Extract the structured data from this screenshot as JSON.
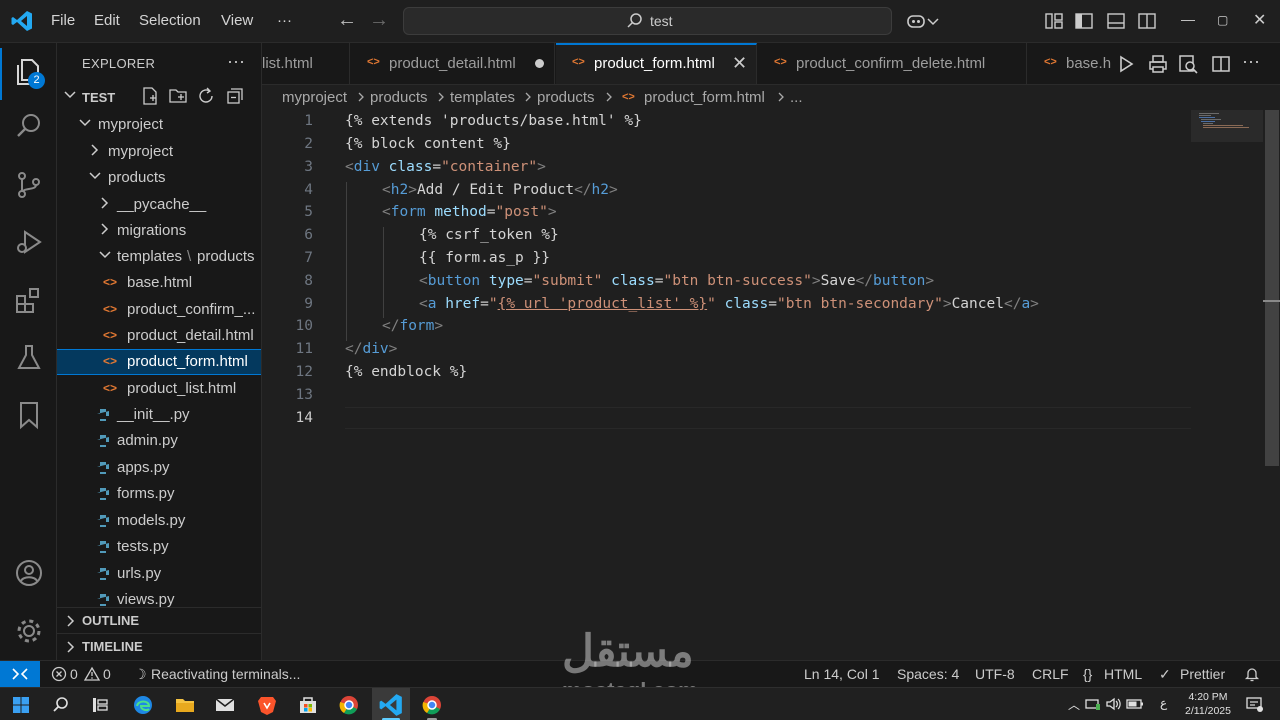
{
  "titlebar": {
    "menu": [
      "File",
      "Edit",
      "Selection",
      "View",
      "···"
    ],
    "search_text": "test"
  },
  "activity": {
    "explorer_badge": "2"
  },
  "explorer": {
    "title": "EXPLORER",
    "more": "···",
    "root": "TEST",
    "items": [
      {
        "label": "myproject",
        "kind": "folder",
        "open": true
      },
      {
        "label": "myproject",
        "kind": "folder",
        "open": false
      },
      {
        "label": "products",
        "kind": "folder",
        "open": true
      },
      {
        "label": "__pycache__",
        "kind": "folder",
        "open": false
      },
      {
        "label": "migrations",
        "kind": "folder",
        "open": false
      },
      {
        "label": "templates",
        "kind": "folder",
        "open": true
      },
      {
        "label": "base.html",
        "kind": "html"
      },
      {
        "label": "product_confirm_...",
        "kind": "html"
      },
      {
        "label": "product_detail.html",
        "kind": "html"
      },
      {
        "label": "product_form.html",
        "kind": "html",
        "selected": true
      },
      {
        "label": "product_list.html",
        "kind": "html"
      },
      {
        "label": "__init__.py",
        "kind": "py"
      },
      {
        "label": "admin.py",
        "kind": "py"
      },
      {
        "label": "apps.py",
        "kind": "py"
      },
      {
        "label": "forms.py",
        "kind": "py"
      },
      {
        "label": "models.py",
        "kind": "py"
      },
      {
        "label": "tests.py",
        "kind": "py"
      },
      {
        "label": "urls.py",
        "kind": "py"
      },
      {
        "label": "views.py",
        "kind": "py"
      }
    ],
    "templates_sep": "\\",
    "templates_sub": "products",
    "outline": "OUTLINE",
    "timeline": "TIMELINE"
  },
  "tabs": [
    {
      "label": "list.html",
      "state": "normal"
    },
    {
      "label": "product_detail.html",
      "state": "modified"
    },
    {
      "label": "product_form.html",
      "state": "active"
    },
    {
      "label": "product_confirm_delete.html",
      "state": "normal"
    },
    {
      "label": "base.h",
      "state": "normal"
    }
  ],
  "tab_close": "✕",
  "tab_more": "···",
  "breadcrumb": [
    "myproject",
    "products",
    "templates",
    "products",
    "product_form.html",
    "..."
  ],
  "editor": {
    "line_numbers": [
      "1",
      "2",
      "3",
      "4",
      "5",
      "6",
      "7",
      "8",
      "9",
      "10",
      "11",
      "12",
      "13",
      "14"
    ],
    "current_line": "14",
    "l1": "{% extends 'products/base.html' %}",
    "l2": "{% block content %}",
    "l3": {
      "tag": "div",
      "attr": "class",
      "val": "\"container\""
    },
    "l4": {
      "tag": "h2",
      "text": "Add / Edit Product"
    },
    "l5": {
      "tag": "form",
      "attr": "method",
      "val": "\"post\""
    },
    "l6": "{% csrf_token %}",
    "l7": "{{ form.as_p }}",
    "l8": {
      "tag": "button",
      "a1": "type",
      "v1": "\"submit\"",
      "a2": "class",
      "v2": "\"btn btn-success\"",
      "text": "Save"
    },
    "l9": {
      "tag": "a",
      "a1": "href",
      "q": "\"",
      "url": "{% url 'product_list' %}",
      "a2": "class",
      "v2": "\"btn btn-secondary\"",
      "text": "Cancel"
    },
    "l10": {
      "tag": "form"
    },
    "l11": {
      "tag": "div"
    },
    "l12": "{% endblock %}"
  },
  "status": {
    "errors": "0",
    "warnings": "0",
    "message": "Reactivating terminals...",
    "position": "Ln 14, Col 1",
    "spaces": "Spaces: 4",
    "encoding": "UTF-8",
    "eol": "CRLF",
    "language": "HTML",
    "formatter": "Prettier"
  },
  "watermark": {
    "arabic": "مستقل",
    "latin": "mostaql.com"
  },
  "taskbar": {
    "lang": "ع",
    "time": "4:20 PM",
    "date": "2/11/2025"
  },
  "colors": {
    "accent": "#0078d4",
    "tag": "#569cd6",
    "attr": "#9cdcfe",
    "string": "#ce9178",
    "html_icon": "#e37933",
    "py_icon": "#519aba"
  }
}
